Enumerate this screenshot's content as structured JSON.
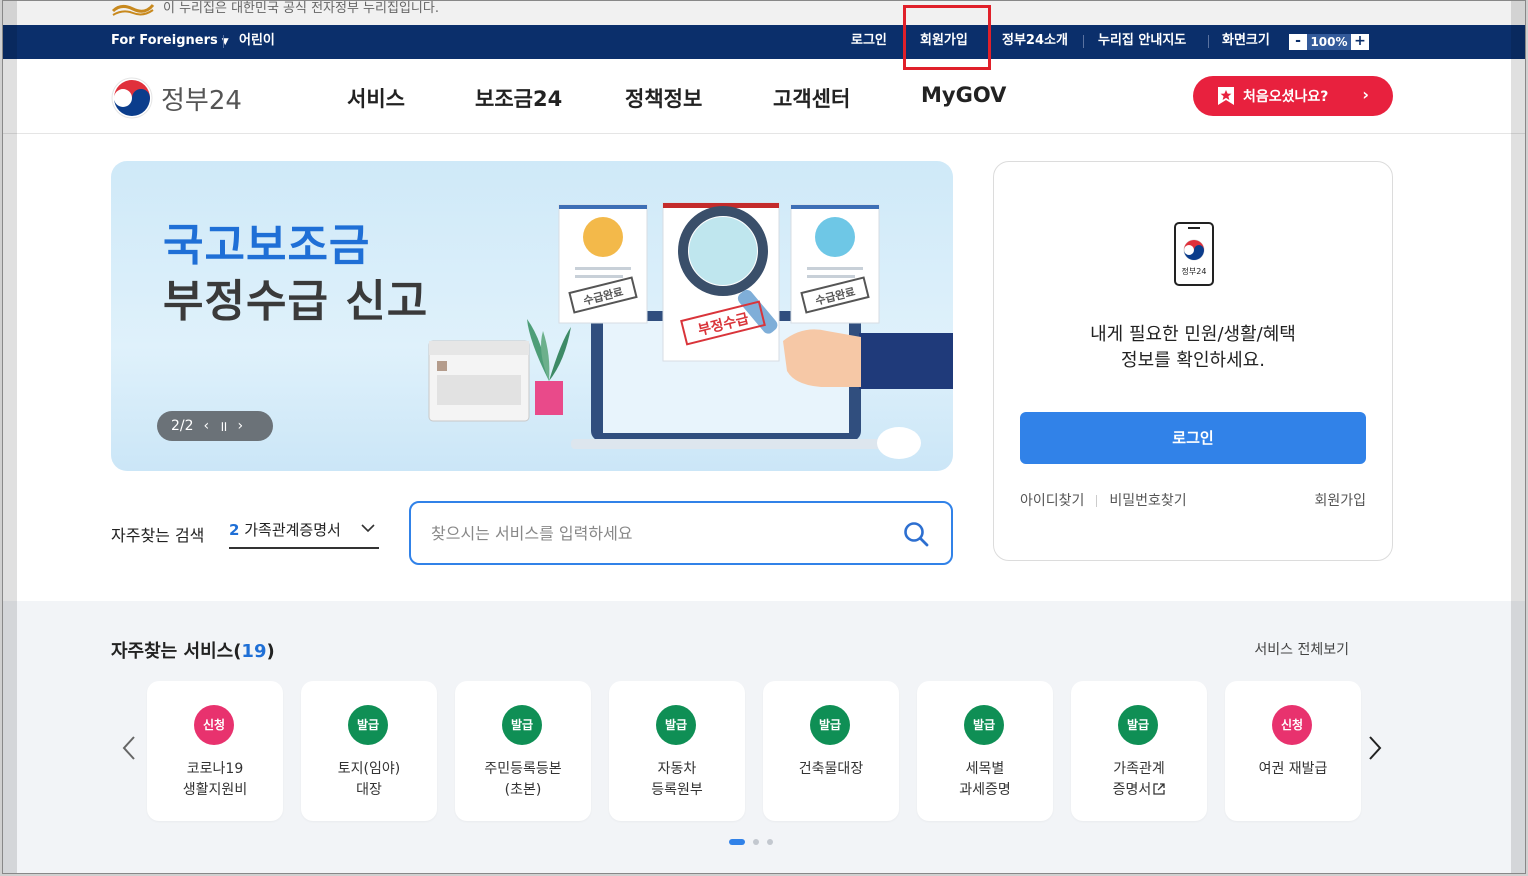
{
  "gov_notice": {
    "text": "이 누리집은 대한민국 공식 전자정부 누리집입니다."
  },
  "util_bar": {
    "for_foreigners": "For Foreigners",
    "kids": "어린이",
    "login": "로그인",
    "signup": "회원가입",
    "about": "정부24소개",
    "sitemap": "누리집 안내지도",
    "screen_size": "화면크기",
    "zoom_minus": "-",
    "zoom_value": "100%",
    "zoom_plus": "+"
  },
  "header": {
    "brand": "정부24",
    "nav": [
      "서비스",
      "보조금24",
      "정책정보",
      "고객센터",
      "MyGOV"
    ],
    "first_visit": "처음오셨나요?",
    "first_visit_arrow": "›"
  },
  "banner": {
    "title_line1": "국고보조금",
    "title_line2": "부정수급 신고",
    "stamp_left": "수급완료",
    "stamp_center": "부정수급",
    "stamp_right": "수급완료",
    "slide_counter": "2/2",
    "prev": "‹",
    "pause": "॥",
    "next": "›"
  },
  "login_card": {
    "phone_label": "정부24",
    "message_line1": "내게 필요한 민원/생활/혜택",
    "message_line2": "정보를 확인하세요.",
    "login_button": "로그인",
    "find_id": "아이디찾기",
    "find_pw": "비밀번호찾기",
    "signup": "회원가입"
  },
  "search": {
    "fav_label": "자주찾는 검색",
    "fav_num": "2",
    "fav_value": "가족관계증명서",
    "placeholder": "찾으시는 서비스를 입력하세요"
  },
  "services": {
    "title": "자주찾는 서비스",
    "count_open": "(",
    "count": "19",
    "count_close": ")",
    "view_all": "서비스 전체보기",
    "items": [
      {
        "badge": "신청",
        "label": "코로나19\n생활지원비"
      },
      {
        "badge": "발급",
        "label": "토지(임야)\n대장"
      },
      {
        "badge": "발급",
        "label": "주민등록등본\n(초본)"
      },
      {
        "badge": "발급",
        "label": "자동차\n등록원부"
      },
      {
        "badge": "발급",
        "label": "건축물대장"
      },
      {
        "badge": "발급",
        "label": "세목별\n과세증명"
      },
      {
        "badge": "발급",
        "label": "가족관계\n증명서"
      },
      {
        "badge": "신청",
        "label": "여권 재발급"
      }
    ]
  },
  "colors": {
    "util_bar": "#0b2f6b",
    "accent_blue": "#3182e8",
    "cta_red": "#e8213e",
    "badge_apply": "#e8326e",
    "badge_issue": "#0f8f55",
    "highlight": "#e0202a"
  }
}
